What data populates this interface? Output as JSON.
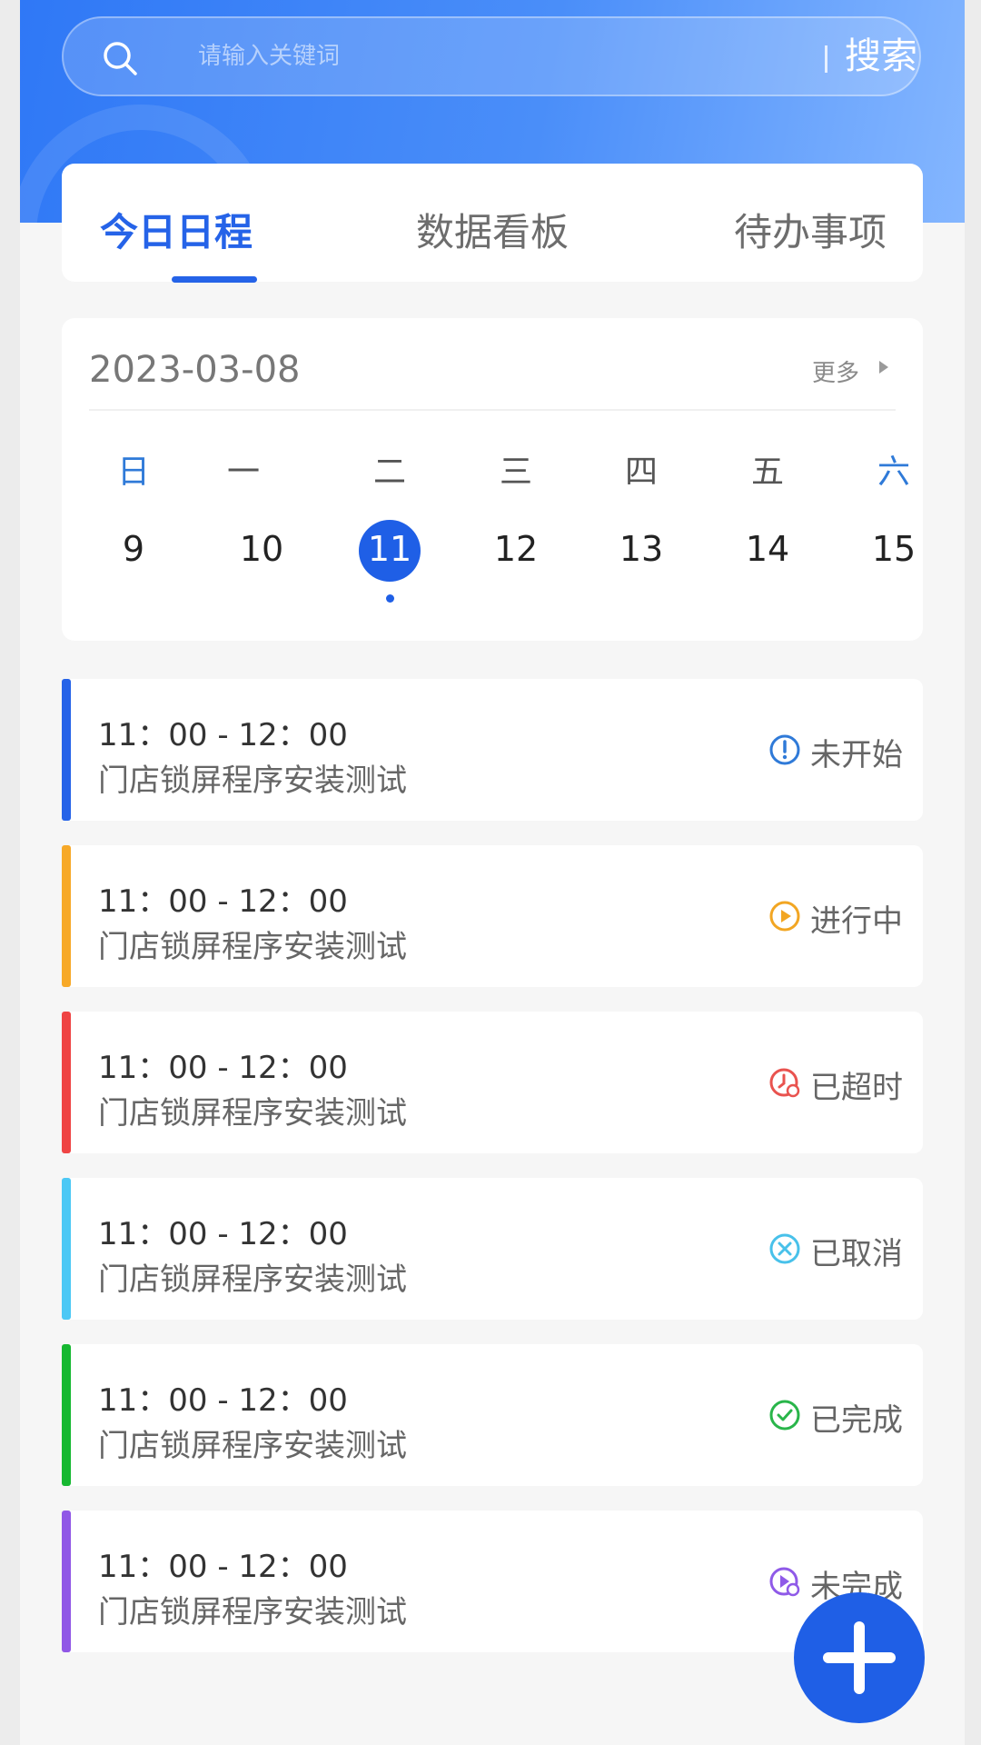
{
  "search": {
    "placeholder": "请输入关键词",
    "button": "搜索"
  },
  "tabs": [
    {
      "label": "今日日程",
      "active": true
    },
    {
      "label": "数据看板",
      "active": false
    },
    {
      "label": "待办事项",
      "active": false
    }
  ],
  "calendar": {
    "date": "2023-03-08",
    "more": "更多",
    "weekdays": [
      "日",
      "一",
      "二",
      "三",
      "四",
      "五",
      "六"
    ],
    "days": [
      "9",
      "10",
      "11",
      "12",
      "13",
      "14",
      "15"
    ],
    "selected_day": "11"
  },
  "schedule": [
    {
      "time": "11：00 - 12：00",
      "title": "门店锁屏程序安装测试",
      "status": "未开始",
      "color": "#2563e8",
      "icon": "exclamation-icon",
      "icon_color": "#2f7ad8"
    },
    {
      "time": "11：00 - 12：00",
      "title": "门店锁屏程序安装测试",
      "status": "进行中",
      "color": "#f7a928",
      "icon": "play-icon",
      "icon_color": "#f2a623"
    },
    {
      "time": "11：00 - 12：00",
      "title": "门店锁屏程序安装测试",
      "status": "已超时",
      "color": "#ef4444",
      "icon": "clock-icon",
      "icon_color": "#e9534f"
    },
    {
      "time": "11：00 - 12：00",
      "title": "门店锁屏程序安装测试",
      "status": "已取消",
      "color": "#4cc8f5",
      "icon": "cancel-icon",
      "icon_color": "#48c1ea"
    },
    {
      "time": "11：00 - 12：00",
      "title": "门店锁屏程序安装测试",
      "status": "已完成",
      "color": "#16b831",
      "icon": "check-icon",
      "icon_color": "#29b54a"
    },
    {
      "time": "11：00 - 12：00",
      "title": "门店锁屏程序安装测试",
      "status": "未完成",
      "color": "#9057e6",
      "icon": "unfinished-icon",
      "icon_color": "#8f5ae8"
    }
  ],
  "fab": {
    "icon": "plus-icon"
  },
  "colors": {
    "primary": "#1f5fe6"
  }
}
